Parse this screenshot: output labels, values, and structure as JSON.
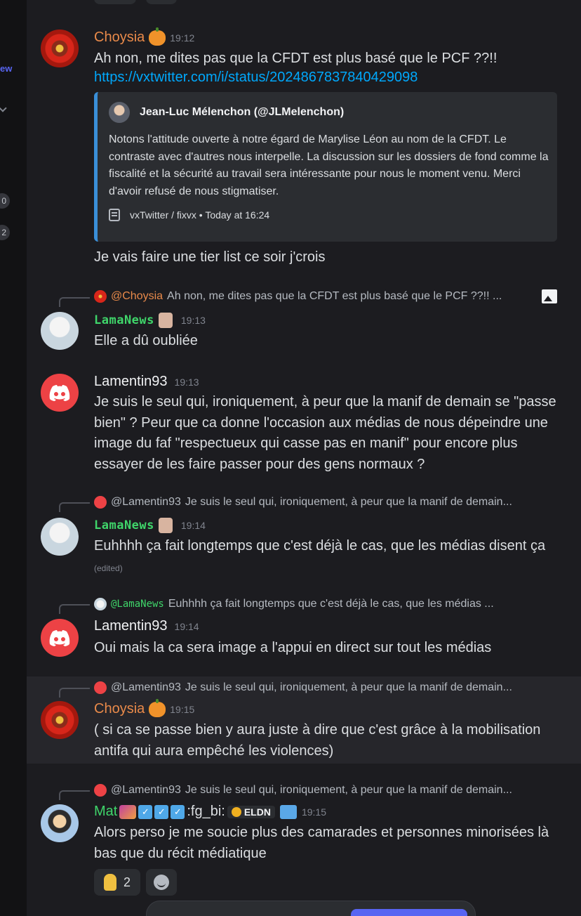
{
  "sidebar": {
    "new_label": "ew",
    "badges": [
      "0",
      "2"
    ]
  },
  "messages": [
    {
      "author": "Choysia",
      "time": "19:12",
      "text": "Ah non, me dites pas que la CFDT est plus basé que le PCF ??!!",
      "link": "https://vxtwitter.com/i/status/2024867837840429098",
      "embed": {
        "author": "Jean-Luc Mélenchon (@JLMelenchon)",
        "description": "Notons l'attitude ouverte à notre égard de Marylise Léon au nom de la CFDT. Le contraste avec d'autres nous interpelle. La discussion sur les dossiers de fond comme la fiscalité et la sécurité au travail sera intéressante pour nous le moment venu. Merci d'avoir refusé de nous stigmatiser.",
        "footer": "vxTwitter / fixvx • Today at 16:24"
      },
      "followup": "Je vais faire une tier list ce soir j'crois"
    },
    {
      "reply_to": "@Choysia",
      "reply_text": "Ah non, me dites pas que la CFDT est plus basé que le PCF ??!! ...",
      "author": "LamaNews",
      "time": "19:13",
      "text": "Elle a dû oubliée"
    },
    {
      "author": "Lamentin93",
      "time": "19:13",
      "text": "Je suis le seul qui, ironiquement, à peur que la manif de demain se \"passe bien\" ? Peur que ca donne l'occasion aux médias de nous dépeindre une image du faf \"respectueux qui casse pas en manif\" pour encore plus essayer de les faire passer pour des gens normaux ?"
    },
    {
      "reply_to": "@Lamentin93",
      "reply_text": "Je suis le seul qui, ironiquement, à peur que la manif de demain...",
      "author": "LamaNews",
      "time": "19:14",
      "text": "Euhhhh ça fait longtemps que c'est déjà le cas, que les médias disent ça",
      "edited": "(edited)"
    },
    {
      "reply_to": "@LamaNews",
      "reply_text": "Euhhhh ça fait longtemps que c'est déjà le cas, que les médias ...",
      "author": "Lamentin93",
      "time": "19:14",
      "text": "Oui mais la ca sera image a l'appui en direct sur tout les médias"
    },
    {
      "reply_to": "@Lamentin93",
      "reply_text": "Je suis le seul qui, ironiquement, à peur que la manif de demain...",
      "author": "Choysia",
      "time": "19:15",
      "text": "( si ca se passe bien y aura juste à dire que c'est grâce à la mobilisation antifa qui aura empêché les violences)"
    },
    {
      "reply_to": "@Lamentin93",
      "reply_text": "Je suis le seul qui, ironiquement, à peur que la manif de demain...",
      "author": "Mat",
      "author_extra": ":fg_bi:",
      "tag": "ELDN",
      "time": "19:15",
      "text": "Alors perso je me soucie plus des camarades et personnes minorisées là bas que du récit médiatique",
      "reaction_count": "2"
    }
  ]
}
